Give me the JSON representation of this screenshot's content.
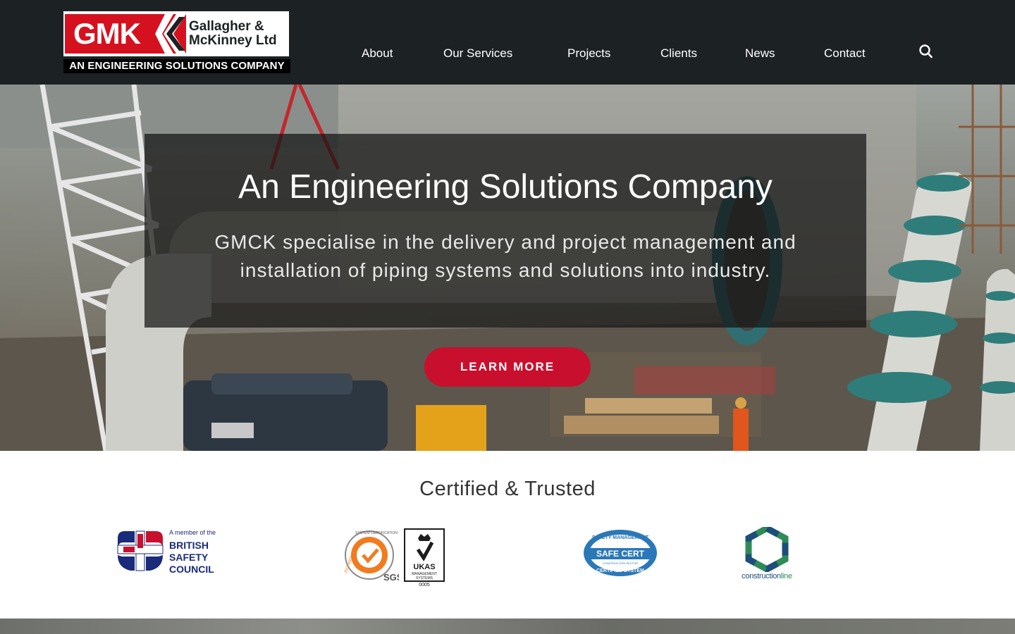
{
  "header": {
    "logo": {
      "mark": "GMK",
      "name_line1": "Gallagher &",
      "name_line2": "McKinney Ltd",
      "tagline": "AN ENGINEERING SOLUTIONS COMPANY"
    },
    "nav": [
      {
        "label": "About"
      },
      {
        "label": "Our Services"
      },
      {
        "label": "Projects"
      },
      {
        "label": "Clients"
      },
      {
        "label": "News"
      },
      {
        "label": "Contact"
      }
    ],
    "search_icon": "search-icon"
  },
  "hero": {
    "title": "An Engineering Solutions Company",
    "subtitle": "GMCK specialise in the delivery and project management and installation of piping systems and solutions into industry.",
    "cta_label": "LEARN MORE"
  },
  "certified": {
    "title": "Certified & Trusted",
    "badges": {
      "bsc": {
        "small": "A member of the",
        "line1": "BRITISH",
        "line2": "SAFETY",
        "line3": "COUNCIL"
      },
      "sgs": {
        "sgs": "SGS",
        "iso": "ISO 9001",
        "ring": "SYSTEM CERTIFICATION"
      },
      "ukas": {
        "name": "UKAS",
        "sub1": "MANAGEMENT",
        "sub2": "SYSTEMS",
        "num": "0005"
      },
      "safecert": {
        "top": "SAFETY MANAGEMENT",
        "name": "SAFE CERT",
        "sector": "CONSTRUCTION SECTOR",
        "bottom": "CERTIFIED SYSTEM"
      },
      "constructionline": {
        "part1": "construction",
        "part2": "line"
      }
    }
  },
  "colors": {
    "header_bg": "#1c2124",
    "brand_red": "#d6111f",
    "cta_red": "#c8102e",
    "bsc_blue": "#1a2b7a"
  }
}
